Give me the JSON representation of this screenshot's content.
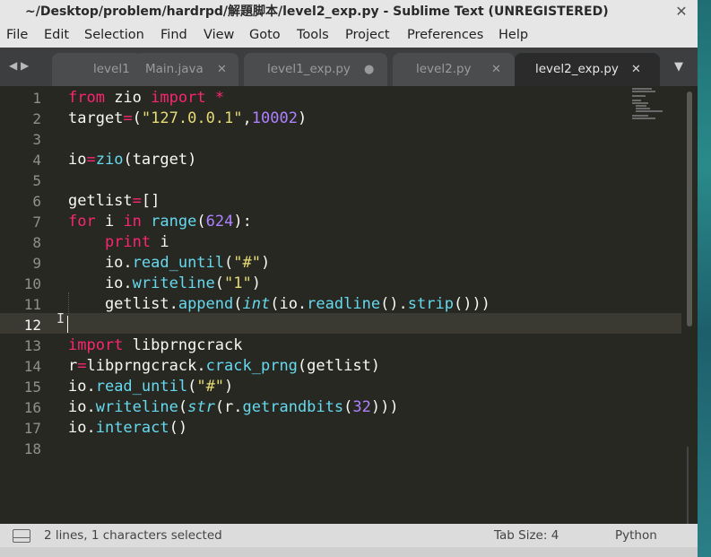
{
  "window": {
    "title": "~/Desktop/problem/hardrpd/解題脚本/level2_exp.py - Sublime Text (UNREGISTERED)",
    "close_glyph": "✕"
  },
  "menu": {
    "items": [
      "File",
      "Edit",
      "Selection",
      "Find",
      "View",
      "Goto",
      "Tools",
      "Project",
      "Preferences",
      "Help"
    ]
  },
  "tabs": {
    "nav_arrows": "◀ ▶",
    "dropdown_glyph": "▼",
    "items": [
      {
        "label": "level1",
        "close": ""
      },
      {
        "label": "Main.java",
        "close": "✕"
      },
      {
        "label": "level1_exp.py",
        "close": "●"
      },
      {
        "label": "level2.py",
        "close": "✕"
      },
      {
        "label": "level2_exp.py",
        "close": "✕",
        "active": true
      }
    ]
  },
  "editor": {
    "current_line": 12,
    "line_numbers": [
      "1",
      "2",
      "3",
      "4",
      "5",
      "6",
      "7",
      "8",
      "9",
      "10",
      "11",
      "12",
      "13",
      "14",
      "15",
      "16",
      "17",
      "18"
    ],
    "lines": [
      [
        {
          "t": "from",
          "c": "kw"
        },
        {
          "t": " zio "
        },
        {
          "t": "import",
          "c": "kw"
        },
        {
          "t": " "
        },
        {
          "t": "*",
          "c": "kw"
        }
      ],
      [
        {
          "t": "target"
        },
        {
          "t": "=",
          "c": "kw"
        },
        {
          "t": "("
        },
        {
          "t": "\"127.0.0.1\"",
          "c": "str"
        },
        {
          "t": ","
        },
        {
          "t": "10002",
          "c": "num"
        },
        {
          "t": ")"
        }
      ],
      [],
      [
        {
          "t": "io"
        },
        {
          "t": "=",
          "c": "kw"
        },
        {
          "t": "zio",
          "c": "fn"
        },
        {
          "t": "(target)"
        }
      ],
      [],
      [
        {
          "t": "getlist"
        },
        {
          "t": "=",
          "c": "kw"
        },
        {
          "t": "[]"
        }
      ],
      [
        {
          "t": "for",
          "c": "kw"
        },
        {
          "t": " i "
        },
        {
          "t": "in",
          "c": "kw"
        },
        {
          "t": " "
        },
        {
          "t": "range",
          "c": "fn"
        },
        {
          "t": "("
        },
        {
          "t": "624",
          "c": "num"
        },
        {
          "t": "):"
        }
      ],
      [
        {
          "t": "    "
        },
        {
          "t": "print",
          "c": "kw"
        },
        {
          "t": " i"
        }
      ],
      [
        {
          "t": "    io."
        },
        {
          "t": "read_until",
          "c": "fn"
        },
        {
          "t": "("
        },
        {
          "t": "\"#\"",
          "c": "str"
        },
        {
          "t": ")"
        }
      ],
      [
        {
          "t": "    io."
        },
        {
          "t": "writeline",
          "c": "fn"
        },
        {
          "t": "("
        },
        {
          "t": "\"1\"",
          "c": "str"
        },
        {
          "t": ")"
        }
      ],
      [
        {
          "t": "    getlist."
        },
        {
          "t": "append",
          "c": "fn"
        },
        {
          "t": "("
        },
        {
          "t": "int",
          "c": "it"
        },
        {
          "t": "(io."
        },
        {
          "t": "readline",
          "c": "fn"
        },
        {
          "t": "()."
        },
        {
          "t": "strip",
          "c": "fn"
        },
        {
          "t": "()))"
        }
      ],
      [],
      [
        {
          "t": "import",
          "c": "kw"
        },
        {
          "t": " libprngcrack"
        }
      ],
      [
        {
          "t": "r"
        },
        {
          "t": "=",
          "c": "kw"
        },
        {
          "t": "libprngcrack."
        },
        {
          "t": "crack_prng",
          "c": "fn"
        },
        {
          "t": "(getlist)"
        }
      ],
      [
        {
          "t": "io."
        },
        {
          "t": "read_until",
          "c": "fn"
        },
        {
          "t": "("
        },
        {
          "t": "\"#\"",
          "c": "str"
        },
        {
          "t": ")"
        }
      ],
      [
        {
          "t": "io."
        },
        {
          "t": "writeline",
          "c": "fn"
        },
        {
          "t": "("
        },
        {
          "t": "str",
          "c": "it"
        },
        {
          "t": "(r."
        },
        {
          "t": "getrandbits",
          "c": "fn"
        },
        {
          "t": "("
        },
        {
          "t": "32",
          "c": "num"
        },
        {
          "t": ")))"
        }
      ],
      [
        {
          "t": "io."
        },
        {
          "t": "interact",
          "c": "fn"
        },
        {
          "t": "()"
        }
      ],
      []
    ],
    "ibeam_glyph": "I"
  },
  "status": {
    "selection": "2 lines, 1 characters selected",
    "tab_size": "Tab Size: 4",
    "syntax": "Python"
  },
  "colors": {
    "keyword": "#f92672",
    "string": "#e6db74",
    "number": "#ae81ff",
    "function": "#66d9ef",
    "background": "#272822"
  }
}
